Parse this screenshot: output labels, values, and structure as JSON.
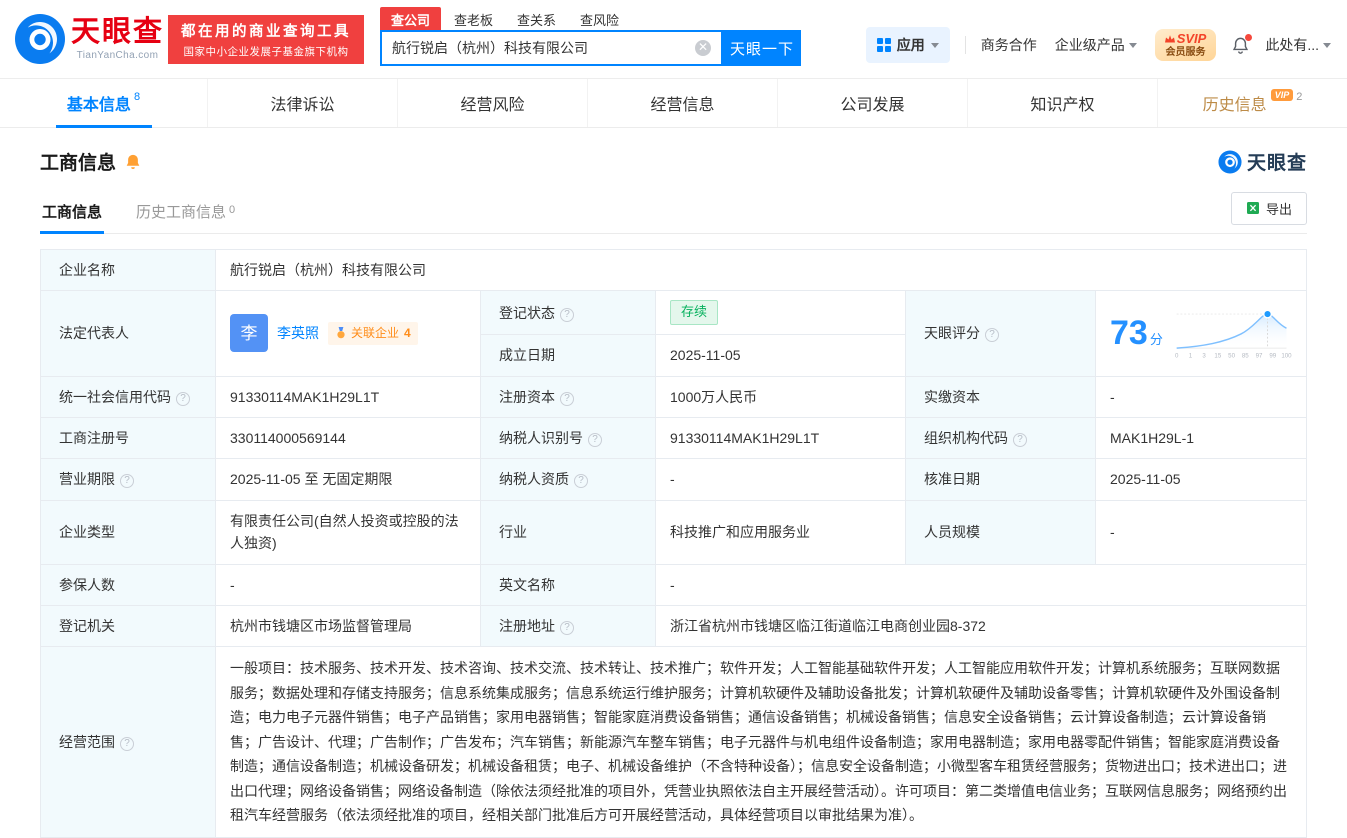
{
  "header": {
    "logo": {
      "brand": "天眼查",
      "domain": "TianYanCha.com"
    },
    "banner": {
      "line1": "都在用的商业查询工具",
      "line2": "国家中小企业发展子基金旗下机构"
    },
    "search": {
      "tabs": [
        {
          "label": "查公司"
        },
        {
          "label": "查老板"
        },
        {
          "label": "查关系"
        },
        {
          "label": "查风险"
        }
      ],
      "value": "航行锐启（杭州）科技有限公司",
      "button": "天眼一下"
    },
    "menu": {
      "apps": "应用",
      "cooperation": "商务合作",
      "enterprise": "企业级产品",
      "svip_line1": "SVIP",
      "svip_line2": "会员服务",
      "more": "此处有..."
    }
  },
  "nav": {
    "tabs": [
      {
        "label": "基本信息",
        "count": "8"
      },
      {
        "label": "法律诉讼"
      },
      {
        "label": "经营风险"
      },
      {
        "label": "经营信息"
      },
      {
        "label": "公司发展"
      },
      {
        "label": "知识产权"
      },
      {
        "label": "历史信息",
        "count": "2",
        "badge": "VIP"
      }
    ]
  },
  "section": {
    "title": "工商信息",
    "brand": "天眼查",
    "tabs": [
      {
        "label": "工商信息"
      },
      {
        "label": "历史工商信息",
        "count": "0"
      }
    ],
    "export_label": "导出"
  },
  "info": {
    "company_name": {
      "label": "企业名称",
      "value": "航行锐启（杭州）科技有限公司"
    },
    "legal_rep": {
      "label": "法定代表人",
      "avatar": "李",
      "name": "李英照",
      "related": "关联企业",
      "related_count": "4"
    },
    "reg_status": {
      "label": "登记状态",
      "value": "存续"
    },
    "establish_date": {
      "label": "成立日期",
      "value": "2025-11-05"
    },
    "score": {
      "label": "天眼评分",
      "value": "73",
      "unit": "分",
      "ticks": [
        "0",
        "1",
        "3",
        "15",
        "50",
        "85",
        "97",
        "99",
        "100"
      ]
    },
    "credit_code": {
      "label": "统一社会信用代码",
      "value": "91330114MAK1H29L1T"
    },
    "reg_capital": {
      "label": "注册资本",
      "value": "1000万人民币"
    },
    "paid_capital": {
      "label": "实缴资本",
      "value": "-"
    },
    "reg_no": {
      "label": "工商注册号",
      "value": "330114000569144"
    },
    "tax_id": {
      "label": "纳税人识别号",
      "value": "91330114MAK1H29L1T"
    },
    "org_code": {
      "label": "组织机构代码",
      "value": "MAK1H29L-1"
    },
    "term": {
      "label": "营业期限",
      "value": "2025-11-05 至 无固定期限"
    },
    "tax_quality": {
      "label": "纳税人资质",
      "value": "-"
    },
    "approve_date": {
      "label": "核准日期",
      "value": "2025-11-05"
    },
    "company_type": {
      "label": "企业类型",
      "value": "有限责任公司(自然人投资或控股的法人独资)"
    },
    "industry": {
      "label": "行业",
      "value": "科技推广和应用服务业"
    },
    "staff_size": {
      "label": "人员规模",
      "value": "-"
    },
    "insured": {
      "label": "参保人数",
      "value": "-"
    },
    "english_name": {
      "label": "英文名称",
      "value": "-"
    },
    "authority": {
      "label": "登记机关",
      "value": "杭州市钱塘区市场监督管理局"
    },
    "address": {
      "label": "注册地址",
      "value": "浙江省杭州市钱塘区临江街道临江电商创业园8-372"
    },
    "scope": {
      "label": "经营范围",
      "value": "一般项目：技术服务、技术开发、技术咨询、技术交流、技术转让、技术推广；软件开发；人工智能基础软件开发；人工智能应用软件开发；计算机系统服务；互联网数据服务；数据处理和存储支持服务；信息系统集成服务；信息系统运行维护服务；计算机软硬件及辅助设备批发；计算机软硬件及辅助设备零售；计算机软硬件及外围设备制造；电力电子元器件销售；电子产品销售；家用电器销售；智能家庭消费设备销售；通信设备销售；机械设备销售；信息安全设备销售；云计算设备制造；云计算设备销售；广告设计、代理；广告制作；广告发布；汽车销售；新能源汽车整车销售；电子元器件与机电组件设备制造；家用电器制造；家用电器零配件销售；智能家庭消费设备制造；通信设备制造；机械设备研发；机械设备租赁；电子、机械设备维护（不含特种设备）；信息安全设备制造；小微型客车租赁经营服务；货物进出口；技术进出口；进出口代理；网络设备销售；网络设备制造（除依法须经批准的项目外，凭营业执照依法自主开展经营活动）。许可项目：第二类增值电信业务；互联网信息服务；网络预约出租汽车经营服务（依法须经批准的项目，经相关部门批准后方可开展经营活动，具体经营项目以审批结果为准）。"
    }
  }
}
